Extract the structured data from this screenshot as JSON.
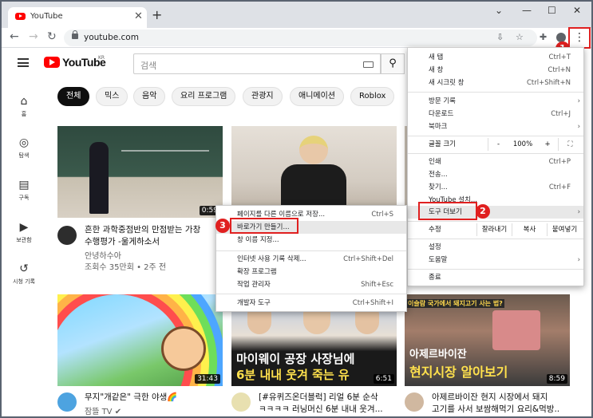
{
  "browser": {
    "tab_title": "YouTube",
    "tab_close": "✕",
    "new_tab": "+",
    "url": "youtube.com",
    "window_controls": {
      "minimize": "—",
      "maximize": "☐",
      "close": "✕",
      "tabsearch": "⌄"
    }
  },
  "youtube": {
    "logo": "YouTube",
    "logo_region": "KR",
    "search_placeholder": "검색",
    "sidebar": [
      {
        "label": "홈",
        "icon": "⌂"
      },
      {
        "label": "탐색",
        "icon": "◎"
      },
      {
        "label": "구독",
        "icon": "▤"
      },
      {
        "label": "보관함",
        "icon": "▶"
      },
      {
        "label": "시청 기록",
        "icon": "↺"
      }
    ],
    "chips": [
      "전체",
      "믹스",
      "음악",
      "요리 프로그램",
      "관광지",
      "애니메이션",
      "Roblox"
    ],
    "videos": [
      {
        "title_line1": "흔한 과학중점반의 만점받는 가창",
        "title_line2": "수행평가 -울게하소서",
        "channel": "안녕하수아",
        "meta": "조회수 35만회 • 2주 전",
        "duration": "0:59"
      },
      {
        "title_line1": "",
        "title_line2": "",
        "channel": "",
        "meta": "",
        "duration": ""
      },
      {
        "title_line1": "",
        "title_line2": "",
        "channel": "",
        "meta": "",
        "duration": ""
      },
      {
        "title_line1": "무지\"개같은\" 극한 야생🌈",
        "title_line2": "",
        "channel": "잠뜰 TV ✔",
        "meta": "",
        "duration": "31:43"
      },
      {
        "title_line1": "[#유퀴즈온더블럭] 리얼 6분 순삭",
        "title_line2": "ㅋㅋㅋㅋ 러닝머신 6분 내내 웃겨...",
        "channel": "",
        "meta": "",
        "duration": "6:51",
        "caption1": "마이웨이 공장 사장님에",
        "caption2": "6분 내내 웃겨 죽는 유"
      },
      {
        "title_line1": "아제르바이잔 현지 시장에서 돼지",
        "title_line2": "고기를 사서 보쌈해먹기 요리&먹방..",
        "channel": "",
        "meta": "",
        "duration": "8:59",
        "caption0": "이슬람 국가에서 돼지고기 사는 법?",
        "caption1": "아제르바이잔",
        "caption2": "현지시장 알아보기"
      }
    ]
  },
  "chrome_menu": {
    "items": [
      {
        "label": "새 탭",
        "shortcut": "Ctrl+T"
      },
      {
        "label": "새 창",
        "shortcut": "Ctrl+N"
      },
      {
        "label": "새 시크릿 창",
        "shortcut": "Ctrl+Shift+N"
      },
      {
        "label": "방문 기록",
        "shortcut": ""
      },
      {
        "label": "다운로드",
        "shortcut": "Ctrl+J"
      },
      {
        "label": "북마크",
        "shortcut": ""
      },
      {
        "label": "인쇄",
        "shortcut": "Ctrl+P"
      },
      {
        "label": "전송...",
        "shortcut": ""
      },
      {
        "label": "찾기...",
        "shortcut": "Ctrl+F"
      },
      {
        "label": "YouTube 설치...",
        "shortcut": ""
      },
      {
        "label": "도구 더보기",
        "shortcut": ""
      },
      {
        "label": "설정",
        "shortcut": ""
      },
      {
        "label": "도움말",
        "shortcut": ""
      },
      {
        "label": "종료",
        "shortcut": ""
      }
    ],
    "zoom_label": "글꼴 크기",
    "zoom_minus": "-",
    "zoom_value": "100%",
    "zoom_plus": "+",
    "fullscreen": "⛶",
    "edit_label": "수정",
    "edit_cut": "잘라내기",
    "edit_copy": "복사",
    "edit_paste": "붙여넣기"
  },
  "submenu": {
    "items": [
      {
        "label": "페이지를 다른 이름으로 저장...",
        "shortcut": "Ctrl+S"
      },
      {
        "label": "바로가기 만들기...",
        "shortcut": ""
      },
      {
        "label": "창 이름 지정...",
        "shortcut": ""
      },
      {
        "label": "인터넷 사용 기록 삭제...",
        "shortcut": "Ctrl+Shift+Del"
      },
      {
        "label": "확장 프로그램",
        "shortcut": ""
      },
      {
        "label": "작업 관리자",
        "shortcut": "Shift+Esc"
      },
      {
        "label": "개발자 도구",
        "shortcut": "Ctrl+Shift+I"
      }
    ]
  },
  "annotations": {
    "step1": "1",
    "step2": "2",
    "step3": "3"
  },
  "colors": {
    "accent": "#e02020",
    "youtube_red": "#ff0000"
  }
}
